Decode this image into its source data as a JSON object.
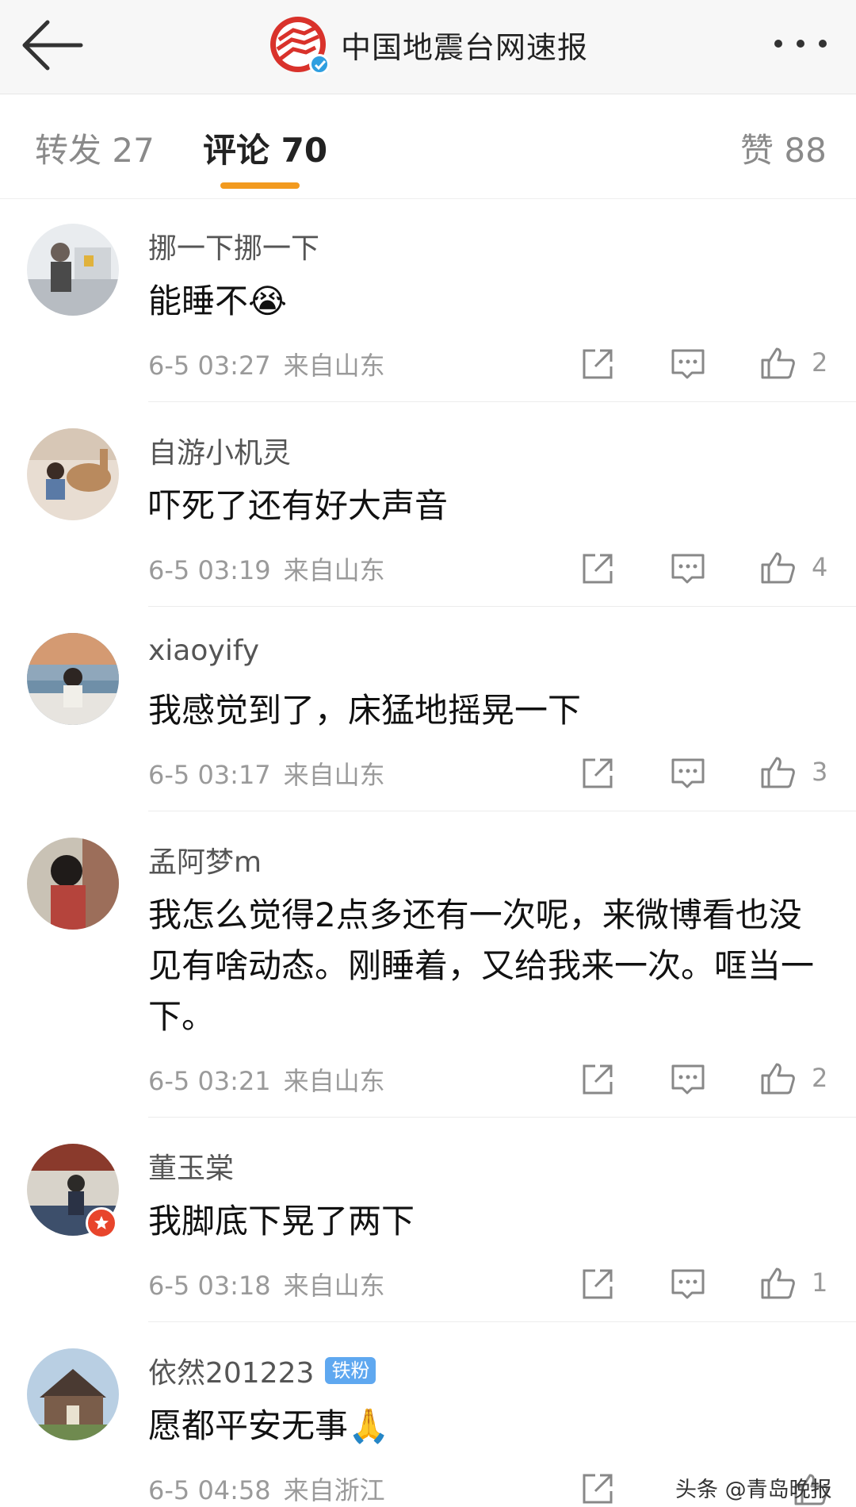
{
  "header": {
    "title": "中国地震台网速报",
    "back_icon": "arrow-left-icon",
    "more_icon": "more-dots-icon",
    "logo_icon": "earthquake-network-logo",
    "verified_icon": "verified-check-icon"
  },
  "tabs": [
    {
      "label": "转发 27",
      "active": false
    },
    {
      "label": "评论 70",
      "active": true
    },
    {
      "label": "赞 88",
      "active": false
    }
  ],
  "accent_color": "#f29a1f",
  "comments": [
    {
      "user": "挪一下挪一下",
      "text": "能睡不😭",
      "time": "6-5 03:27",
      "location": "来自山东",
      "likes": "2"
    },
    {
      "user": "自游小机灵",
      "text": "吓死了还有好大声音",
      "time": "6-5 03:19",
      "location": "来自山东",
      "likes": "4"
    },
    {
      "user": "xiaoyify",
      "text": "我感觉到了，床猛地摇晃一下",
      "time": "6-5 03:17",
      "location": "来自山东",
      "likes": "3"
    },
    {
      "user": "孟阿梦m",
      "text": "我怎么觉得2点多还有一次呢，来微博看也没见有啥动态。刚睡着，又给我来一次。哐当一下。",
      "time": "6-5 03:21",
      "location": "来自山东",
      "likes": "2"
    },
    {
      "user": "董玉棠",
      "text": "我脚底下晃了两下",
      "time": "6-5 03:18",
      "location": "来自山东",
      "likes": "1"
    },
    {
      "user": "依然201223",
      "badge": "铁粉",
      "text": "愿都平安无事🙏",
      "time": "6-5 04:58",
      "location": "来自浙江",
      "likes": ""
    }
  ],
  "watermark": "头条 @青岛晚报"
}
